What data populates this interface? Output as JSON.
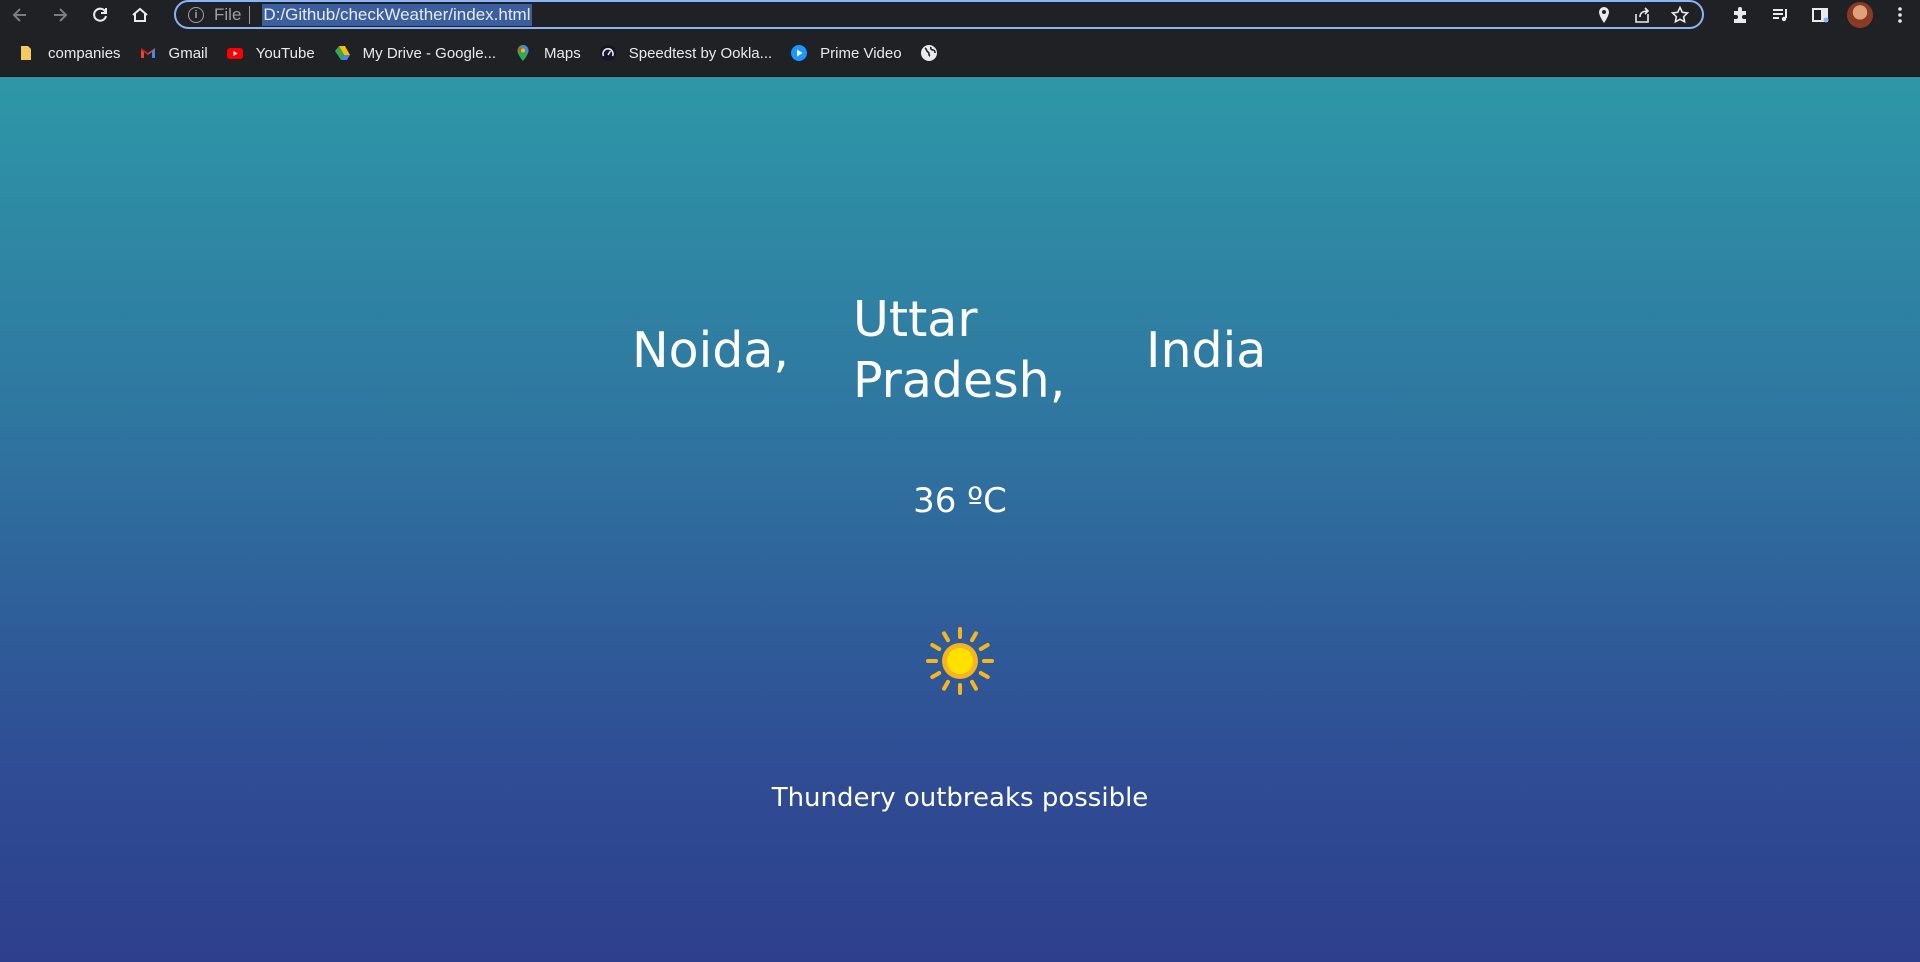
{
  "browser": {
    "address_scheme": "File",
    "address_url": "D:/Github/checkWeather/index.html",
    "accent_color": "#8ab4f8",
    "bookmarks": [
      {
        "label": "companies",
        "icon": "folder-icon"
      },
      {
        "label": "Gmail",
        "icon": "gmail-icon"
      },
      {
        "label": "YouTube",
        "icon": "youtube-icon"
      },
      {
        "label": "My Drive - Google...",
        "icon": "google-drive-icon"
      },
      {
        "label": "Maps",
        "icon": "google-maps-icon"
      },
      {
        "label": "Speedtest by Ookla...",
        "icon": "speedtest-icon"
      },
      {
        "label": "Prime Video",
        "icon": "prime-video-icon"
      },
      {
        "label": "",
        "icon": "globe-icon"
      }
    ]
  },
  "weather": {
    "city": "Noida,",
    "region": "Uttar Pradesh,",
    "country": "India",
    "temperature": "36 ºC",
    "condition": "Thundery outbreaks possible",
    "icon": "sun-icon",
    "gradient_top": "#2e97a7",
    "gradient_bottom": "#2e3f8d"
  }
}
